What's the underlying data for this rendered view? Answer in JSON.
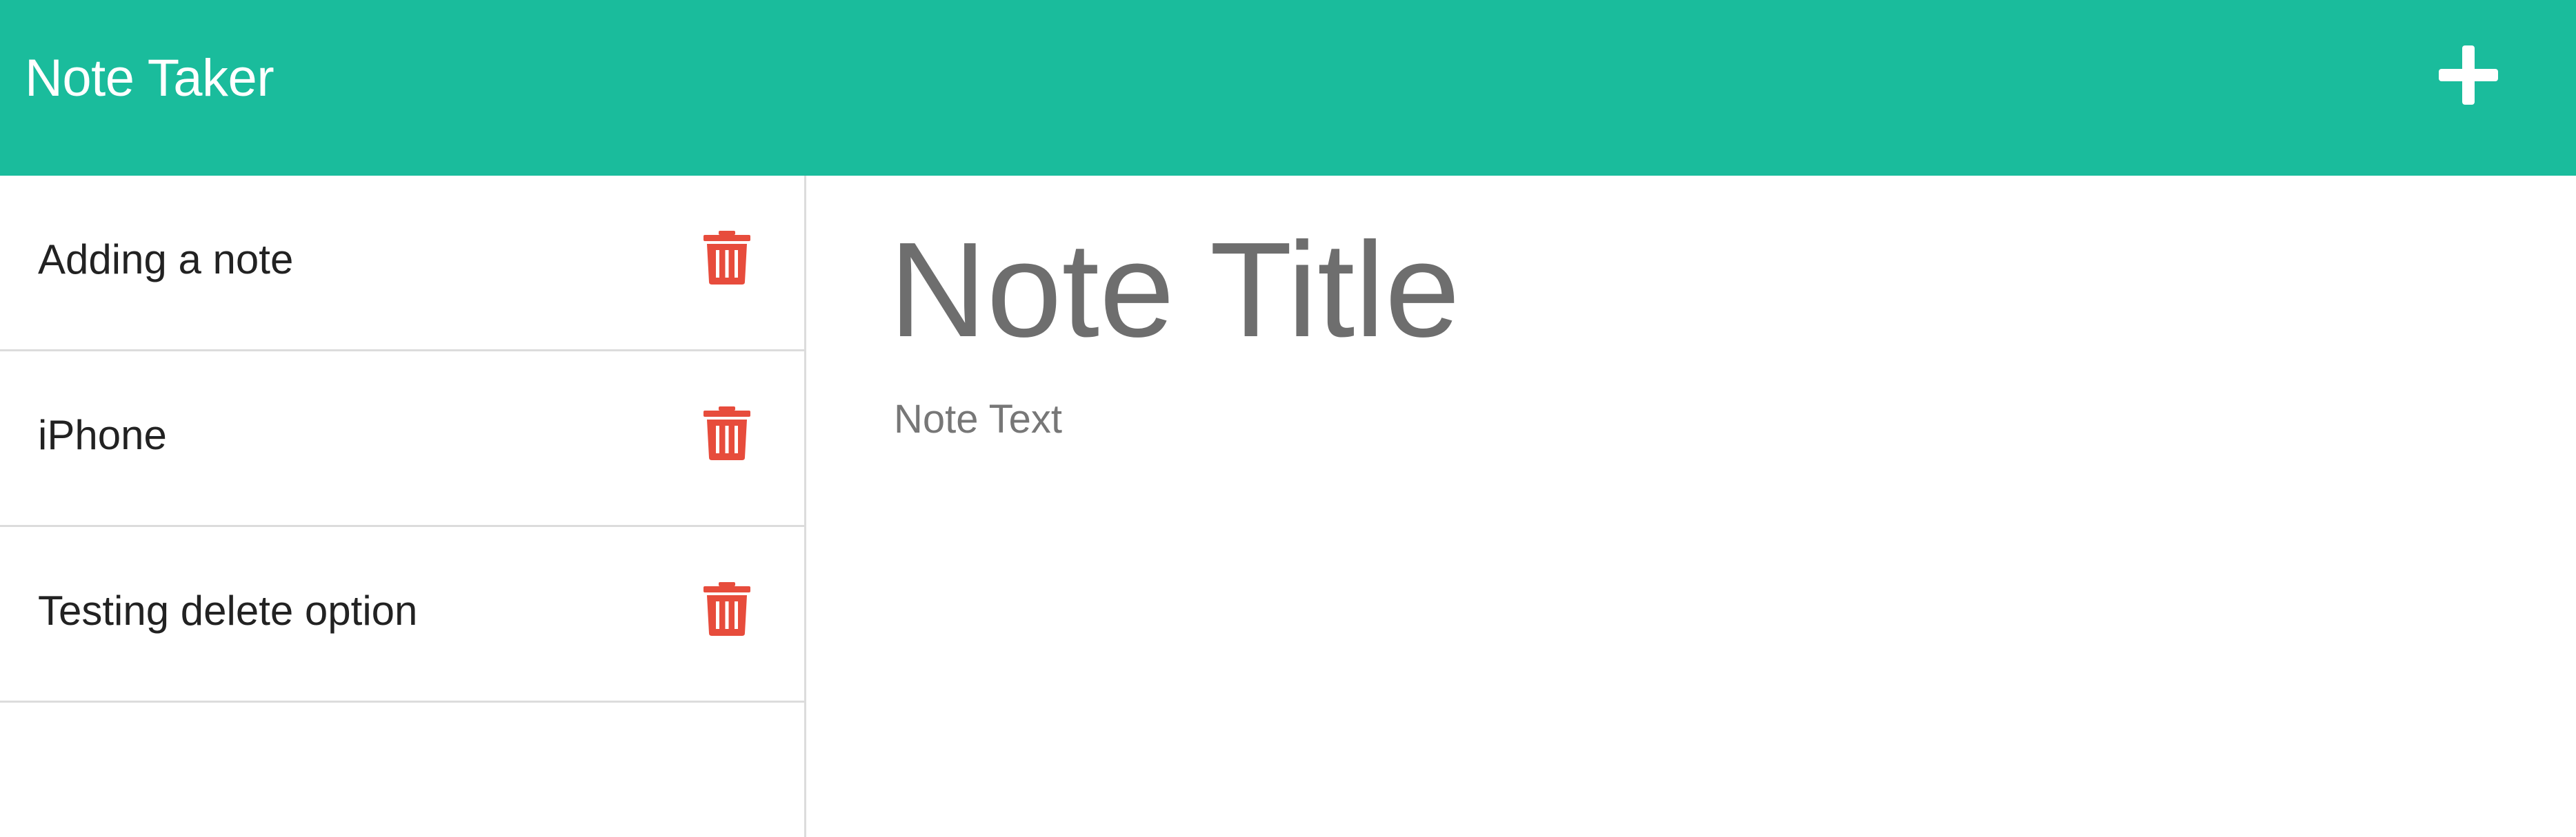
{
  "navbar": {
    "brand": "Note Taker",
    "new_note_icon": "plus-icon",
    "bg_color": "#1abc9c"
  },
  "sidebar": {
    "delete_icon": "trash-icon",
    "delete_color": "#e74c3c",
    "notes": [
      {
        "title": "Adding a note"
      },
      {
        "title": "iPhone"
      },
      {
        "title": "Testing delete option"
      }
    ]
  },
  "editor": {
    "title_placeholder": "Note Title",
    "text_placeholder": "Note Text"
  }
}
